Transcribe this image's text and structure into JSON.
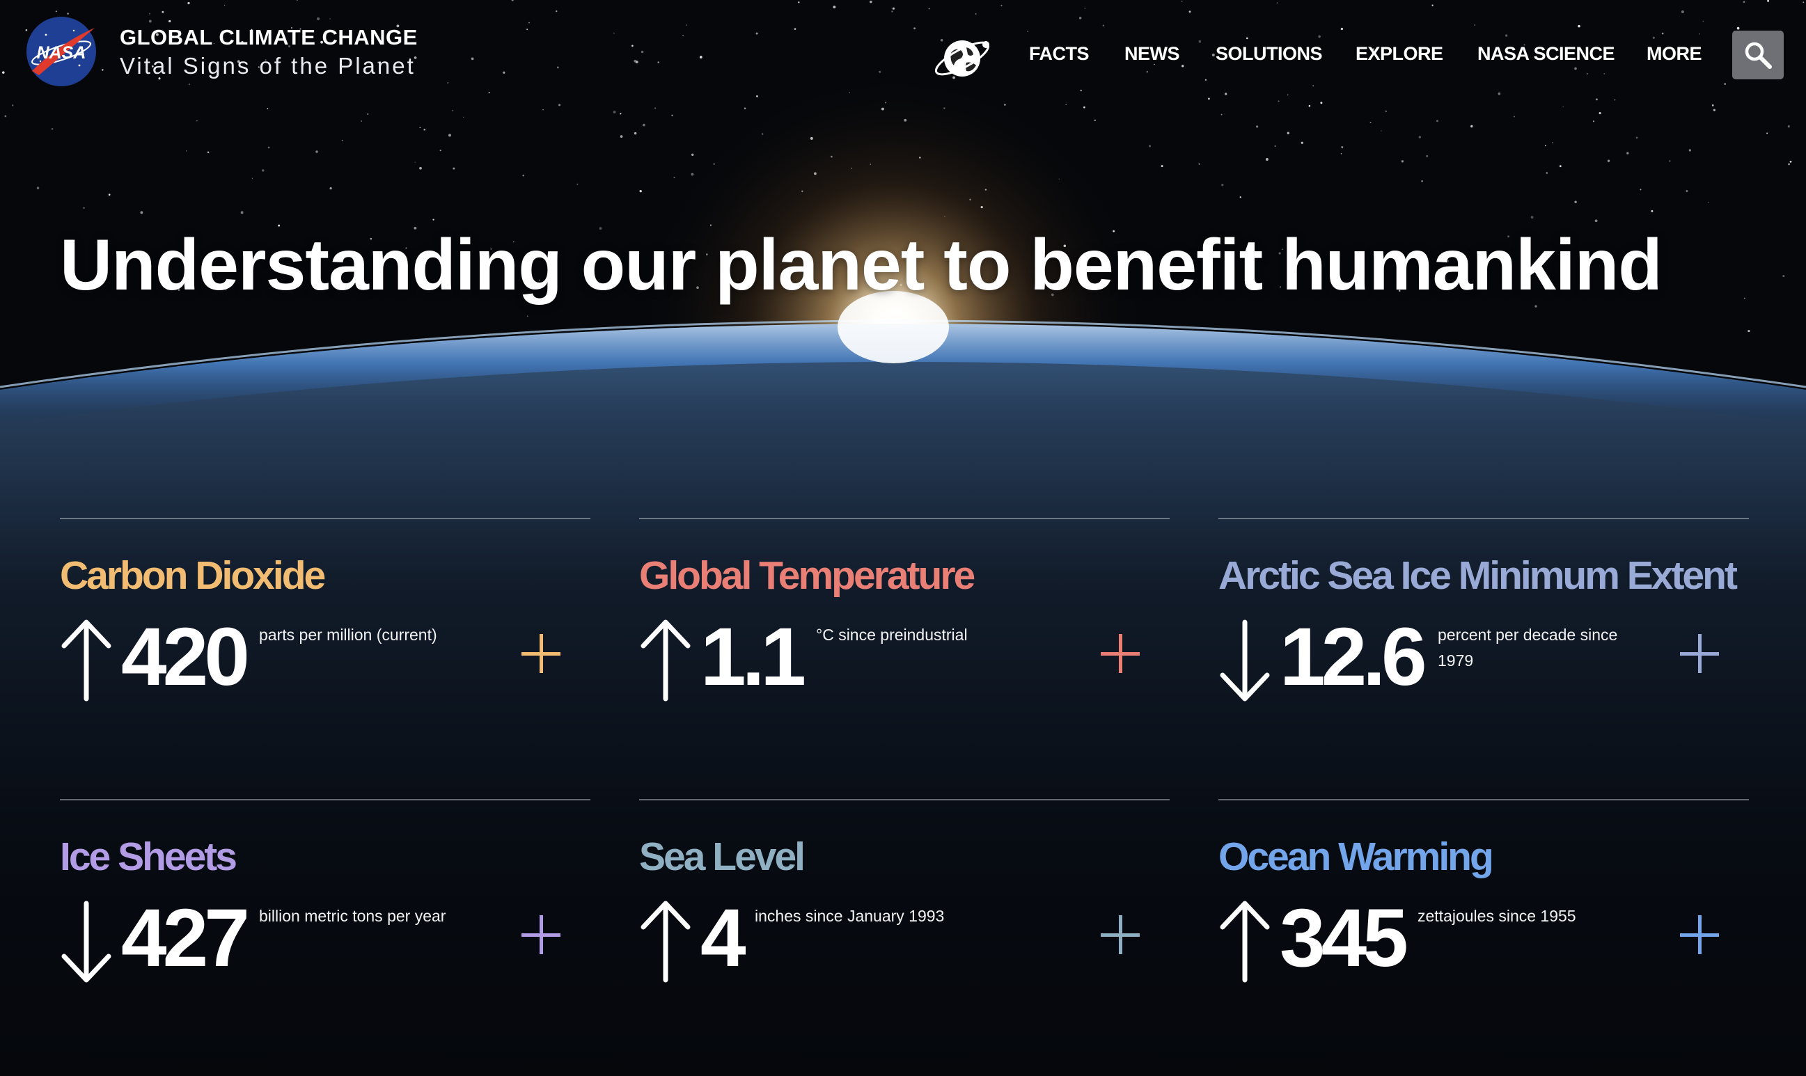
{
  "header": {
    "logo_alt": "NASA",
    "site_title": "GLOBAL CLIMATE CHANGE",
    "site_subtitle": "Vital Signs of the Planet",
    "nav": [
      "FACTS",
      "NEWS",
      "SOLUTIONS",
      "EXPLORE",
      "NASA SCIENCE",
      "MORE"
    ],
    "icons": {
      "globe": "globe-orbit-icon",
      "search": "search-icon"
    }
  },
  "hero": {
    "title": "Understanding our planet to benefit humankind"
  },
  "vital_signs": [
    {
      "name": "Carbon Dioxide",
      "direction": "up",
      "value": "420",
      "unit": "parts per million (current)",
      "color": "#f2bd72"
    },
    {
      "name": "Global Temperature",
      "direction": "up",
      "value": "1.1",
      "unit": "°C since preindustrial",
      "color": "#ea7f76"
    },
    {
      "name": "Arctic Sea Ice Minimum Extent",
      "direction": "down",
      "value": "12.6",
      "unit": "percent per decade since 1979",
      "color": "#9aaad6"
    },
    {
      "name": "Ice Sheets",
      "direction": "down",
      "value": "427",
      "unit": "billion metric tons per year",
      "color": "#b39ce6"
    },
    {
      "name": "Sea Level",
      "direction": "up",
      "value": "4",
      "unit": "inches since January 1993",
      "color": "#8fb0c2"
    },
    {
      "name": "Ocean Warming",
      "direction": "up",
      "value": "345",
      "unit": "zettajoules since 1955",
      "color": "#72a5ea"
    }
  ],
  "colors": {
    "background": "#05070b",
    "search_button": "#6e7075",
    "nasa_blue": "#1f3f95",
    "nasa_red": "#e03a2c"
  }
}
